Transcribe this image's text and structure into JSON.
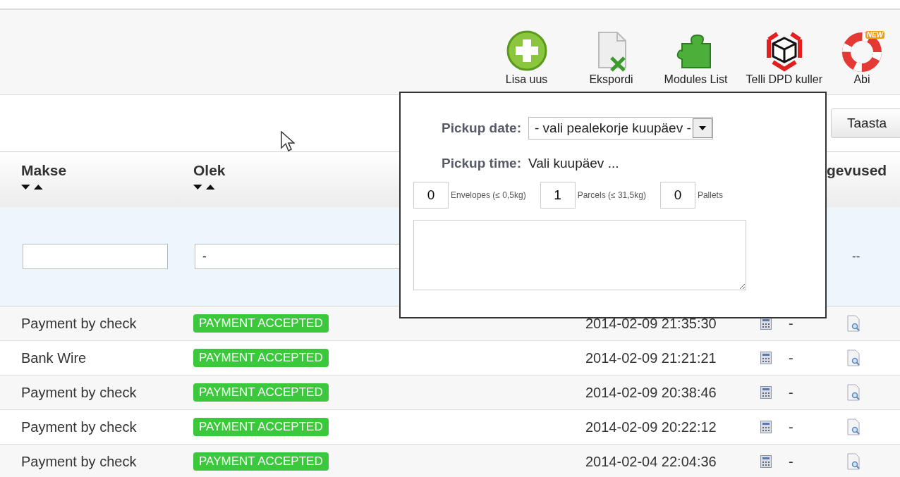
{
  "toolbar": [
    {
      "kind": "add",
      "label": "Lisa uus"
    },
    {
      "kind": "export",
      "label": "Ekspordi"
    },
    {
      "kind": "modules",
      "label": "Modules List"
    },
    {
      "kind": "courier",
      "label": "Telli DPD kuller"
    },
    {
      "kind": "help",
      "label": "Abi",
      "badge": "NEW"
    }
  ],
  "reset_button": "Taasta",
  "table": {
    "columns": [
      {
        "label": "Makse",
        "sortable": true
      },
      {
        "label": "Olek",
        "sortable": true
      },
      {
        "label": "gevused",
        "sortable": false
      }
    ],
    "filters": {
      "status": "-",
      "actions": "--"
    },
    "rows": [
      {
        "payment": "Payment by check",
        "status": "PAYMENT ACCEPTED",
        "color": "#3cc83c",
        "date": "2014-02-09 21:35:30",
        "note": "-"
      },
      {
        "payment": "Bank Wire",
        "status": "PAYMENT ACCEPTED",
        "color": "#3cc83c",
        "date": "2014-02-09 21:21:21",
        "note": "-"
      },
      {
        "payment": "Payment by check",
        "status": "PAYMENT ACCEPTED",
        "color": "#3cc83c",
        "date": "2014-02-09 20:38:46",
        "note": "-"
      },
      {
        "payment": "Payment by check",
        "status": "PAYMENT ACCEPTED",
        "color": "#3cc83c",
        "date": "2014-02-09 20:22:12",
        "note": "-"
      },
      {
        "payment": "Payment by check",
        "status": "PAYMENT ACCEPTED",
        "color": "#3cc83c",
        "date": "2014-02-04 22:04:36",
        "note": "-"
      }
    ]
  },
  "pickup_popup": {
    "date_label": "Pickup date:",
    "date_value": "- vali pealekorje kuupäev -",
    "time_label": "Pickup time:",
    "time_value": "Vali kuupäev ...",
    "quantities": [
      {
        "value": "0",
        "label": "Envelopes (≤ 0,5kg)"
      },
      {
        "value": "1",
        "label": "Parcels (≤ 31,5kg)"
      },
      {
        "value": "0",
        "label": "Pallets"
      }
    ]
  }
}
